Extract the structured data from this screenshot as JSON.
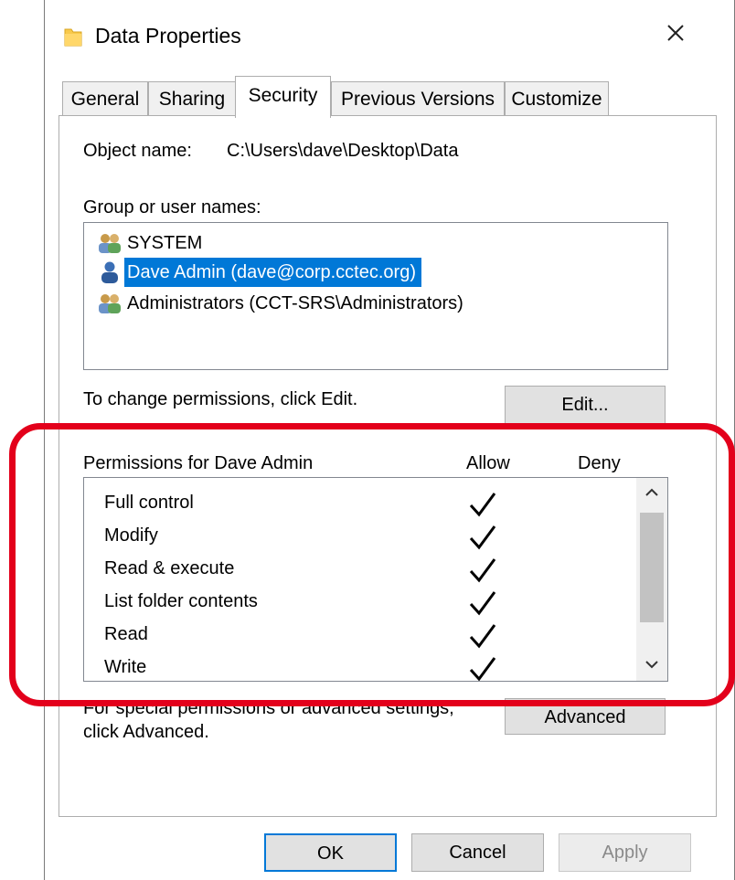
{
  "window": {
    "title": "Data Properties",
    "folder_icon": "folder-icon",
    "close_icon": "close-icon"
  },
  "tabs": [
    {
      "label": "General",
      "active": false
    },
    {
      "label": "Sharing",
      "active": false
    },
    {
      "label": "Security",
      "active": true
    },
    {
      "label": "Previous Versions",
      "active": false
    },
    {
      "label": "Customize",
      "active": false
    }
  ],
  "security": {
    "object_name_label": "Object name:",
    "object_name_value": "C:\\Users\\dave\\Desktop\\Data",
    "group_label": "Group or user names:",
    "users": [
      {
        "name": "SYSTEM",
        "icon": "group-icon",
        "selected": false
      },
      {
        "name": "Dave Admin (dave@corp.cctec.org)",
        "icon": "user-icon",
        "selected": true
      },
      {
        "name": "Administrators (CCT-SRS\\Administrators)",
        "icon": "group-icon",
        "selected": false
      }
    ],
    "change_hint": "To change permissions, click Edit.",
    "edit_button": "Edit...",
    "permissions_label": "Permissions for Dave Admin",
    "allow_header": "Allow",
    "deny_header": "Deny",
    "permissions": [
      {
        "name": "Full control",
        "allow": true,
        "deny": false
      },
      {
        "name": "Modify",
        "allow": true,
        "deny": false
      },
      {
        "name": "Read & execute",
        "allow": true,
        "deny": false
      },
      {
        "name": "List folder contents",
        "allow": true,
        "deny": false
      },
      {
        "name": "Read",
        "allow": true,
        "deny": false
      },
      {
        "name": "Write",
        "allow": true,
        "deny": false
      }
    ],
    "advanced_hint_line1": "For special permissions or advanced settings,",
    "advanced_hint_line2": "click Advanced.",
    "advanced_button": "Advanced"
  },
  "footer": {
    "ok": "OK",
    "cancel": "Cancel",
    "apply": "Apply"
  },
  "colors": {
    "selection": "#0078d7",
    "highlight_box": "#e3001b",
    "ok_border": "#0078d7"
  }
}
